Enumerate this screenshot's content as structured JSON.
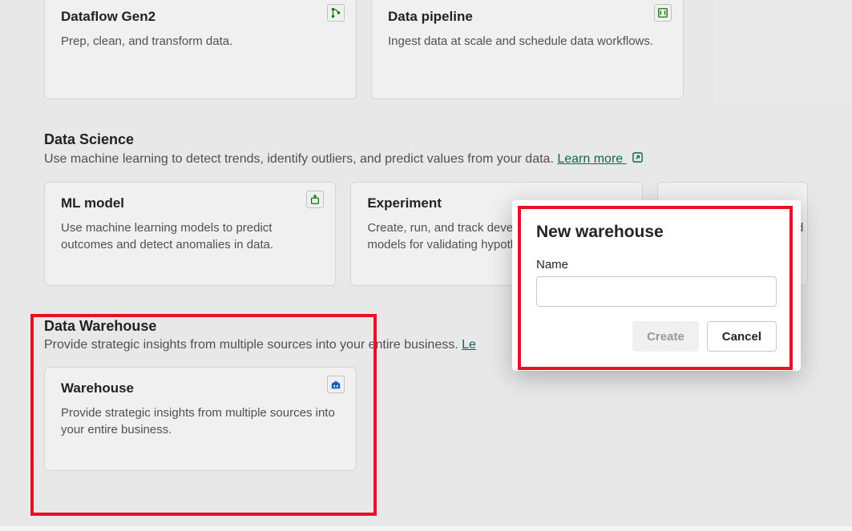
{
  "top_cards": {
    "dataflow": {
      "title": "Dataflow Gen2",
      "desc": "Prep, clean, and transform data."
    },
    "pipeline": {
      "title": "Data pipeline",
      "desc": "Ingest data at scale and schedule data workflows."
    }
  },
  "sections": {
    "ds": {
      "title": "Data Science",
      "desc": "Use machine learning to detect trends, identify outliers, and predict values from your data. ",
      "learn_more": "Learn more ",
      "cards": {
        "ml": {
          "title": "ML model",
          "desc": "Use machine learning models to predict outcomes and detect anomalies in data."
        },
        "exp": {
          "title": "Experiment",
          "desc": "Create, run, and track development of multiple models for validating hypotheses."
        },
        "nb": {
          "desc_partial": "build machine learning applications."
        }
      }
    },
    "dw": {
      "title": "Data Warehouse",
      "desc": "Provide strategic insights from multiple sources into your entire business. ",
      "learn_more_partial": "Le",
      "cards": {
        "wh": {
          "title": "Warehouse",
          "desc": "Provide strategic insights from multiple sources into your entire business."
        }
      }
    }
  },
  "modal": {
    "title": "New warehouse",
    "label": "Name",
    "create": "Create",
    "cancel": "Cancel"
  }
}
